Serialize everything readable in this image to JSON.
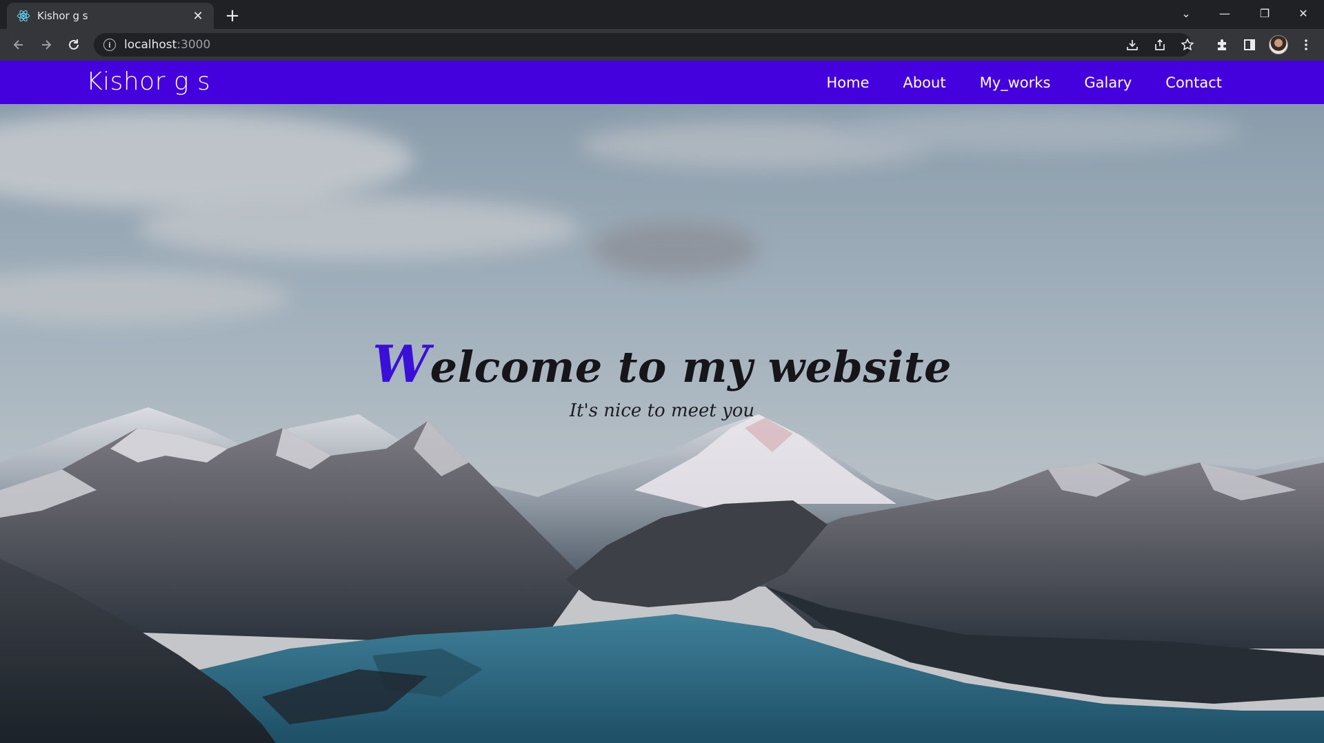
{
  "browser": {
    "tab_title": "Kishor g s",
    "tab_close": "✕",
    "new_tab": "+",
    "url_host": "localhost",
    "url_port": ":3000",
    "controls": {
      "dropdown": "⌄",
      "minimize": "—",
      "restore": "❐",
      "close": "✕"
    }
  },
  "site": {
    "brand": "Kishor g s",
    "nav": [
      "Home",
      "About",
      "My_works",
      "Galary",
      "Contact"
    ],
    "hero": {
      "headline_accent": "W",
      "headline_rest": "elcome to my website",
      "subline": "It's nice to meet you"
    },
    "colors": {
      "navbar": "#4400dd",
      "accent": "#3a10d8"
    }
  }
}
